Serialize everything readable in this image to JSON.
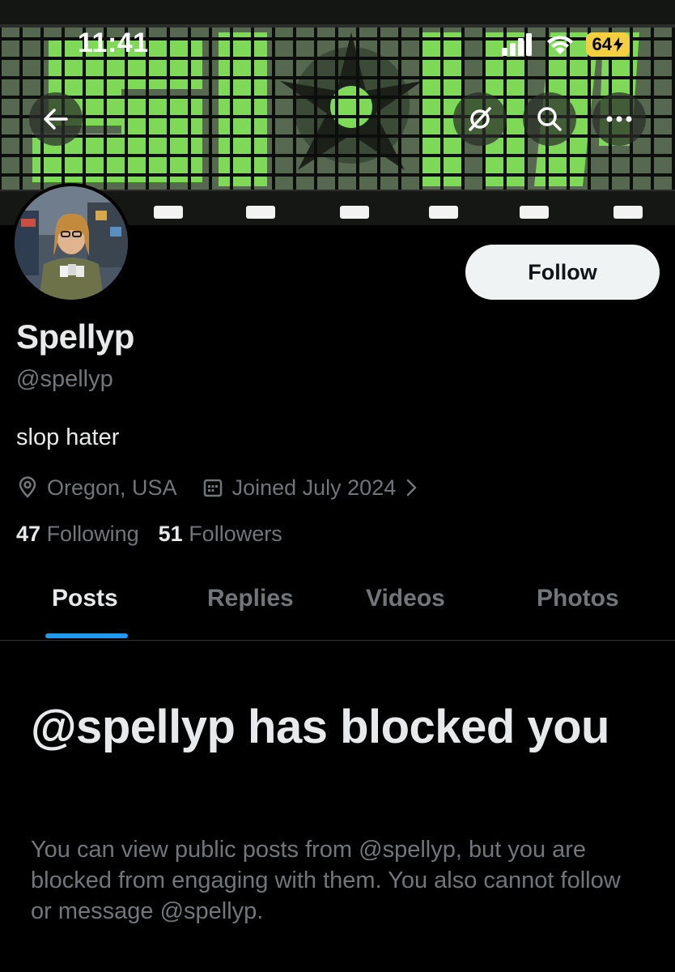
{
  "status_bar": {
    "time": "11:41",
    "battery": "64",
    "icons": [
      "cellular-signal-icon",
      "wifi-icon",
      "battery-charging-icon"
    ]
  },
  "header": {
    "buttons": [
      "back-arrow-icon",
      "grok-icon",
      "search-icon",
      "more-icon"
    ]
  },
  "profile": {
    "display_name": "Spellyp",
    "handle": "@spellyp",
    "bio": "slop hater",
    "location": "Oregon, USA",
    "joined": "Joined July 2024",
    "following_count": "47",
    "following_label": "Following",
    "followers_count": "51",
    "followers_label": "Followers"
  },
  "actions": {
    "follow_label": "Follow"
  },
  "tabs": [
    {
      "label": "Posts",
      "active": true
    },
    {
      "label": "Replies",
      "active": false
    },
    {
      "label": "Videos",
      "active": false
    },
    {
      "label": "Photos",
      "active": false
    }
  ],
  "blocked": {
    "title": "@spellyp has blocked you",
    "body": "You can view public posts from @spellyp, but you are blocked from engaging with them. You also cannot follow or message @spellyp."
  },
  "colors": {
    "background": "#000000",
    "text_primary": "#e7e9ea",
    "text_secondary": "#71767b",
    "accent": "#1d9bf0",
    "follow_bg": "#eff3f4",
    "battery": "#f4d03f",
    "banner_green": "#7ed957"
  }
}
